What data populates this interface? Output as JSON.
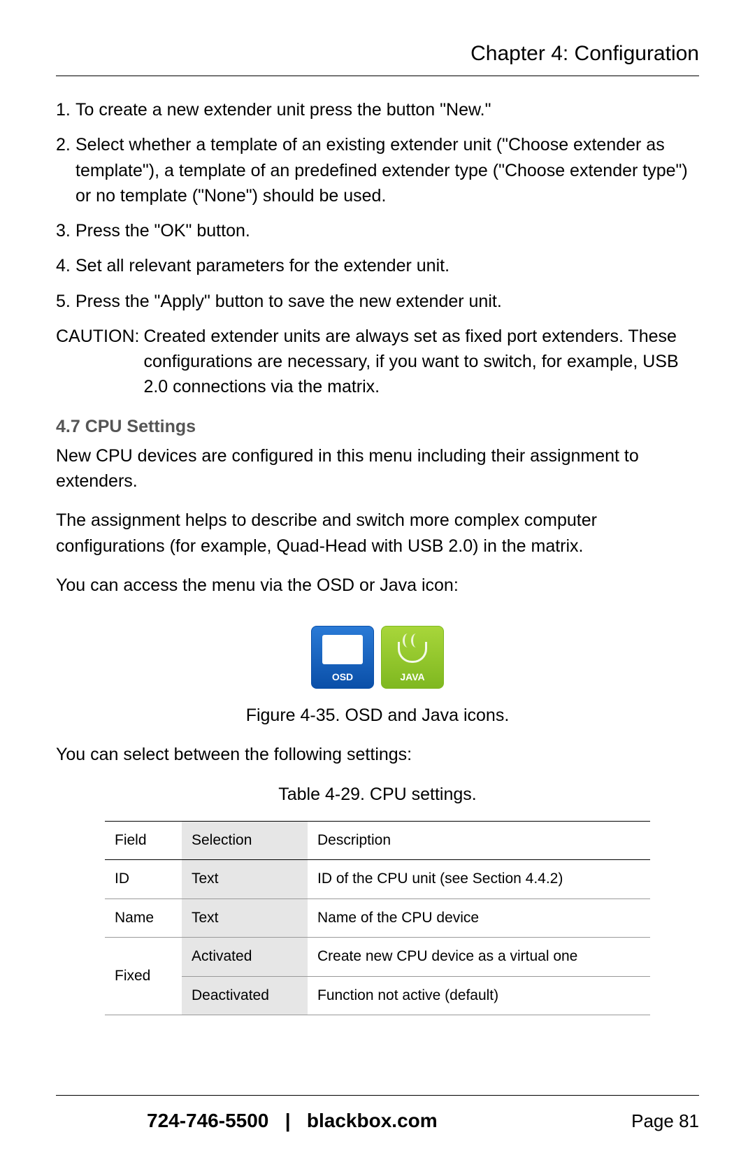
{
  "header": {
    "title": "Chapter 4: Configuration"
  },
  "steps": [
    {
      "num": "1.",
      "text": "To create a new extender unit press the button \"New.\""
    },
    {
      "num": "2.",
      "text": "Select whether a template of an existing extender unit (\"Choose extender as template\"), a template of an predefined extender type (\"Choose extender type\") or no template (\"None\") should be used."
    },
    {
      "num": "3.",
      "text": "Press the \"OK\" button."
    },
    {
      "num": "4.",
      "text": "Set all relevant parameters for the extender unit."
    },
    {
      "num": "5.",
      "text": "Press the \"Apply\" button to save the new extender unit."
    }
  ],
  "caution": {
    "label": "CAUTION:",
    "text": "Created extender units are always set as fixed port extenders. These configurations are necessary, if you want to switch, for example, USB 2.0 connections via the matrix."
  },
  "section": {
    "heading": "4.7 CPU Settings"
  },
  "paras": {
    "p1": "New CPU devices are configured in this menu including their assignment to extenders.",
    "p2": "The assignment helps to describe and switch more complex computer configurations (for example, Quad-Head with USB 2.0) in the matrix.",
    "p3": "You can access the menu via the OSD or Java icon:",
    "p4": "You can select between the following settings:"
  },
  "icons": {
    "osd": "OSD",
    "java": "JAVA"
  },
  "figure_caption": "Figure 4-35. OSD and Java icons.",
  "table_caption": "Table 4-29. CPU settings.",
  "table": {
    "headers": {
      "field": "Field",
      "selection": "Selection",
      "description": "Description"
    },
    "rows": [
      {
        "field": "ID",
        "selection": "Text",
        "description": "ID of the CPU unit (see Section 4.4.2)"
      },
      {
        "field": "Name",
        "selection": "Text",
        "description": "Name of the CPU device"
      },
      {
        "field": "Fixed",
        "selection": "Activated",
        "description": "Create new CPU device as a virtual one"
      },
      {
        "field": "",
        "selection": "Deactivated",
        "description": "Function not active (default)"
      }
    ]
  },
  "footer": {
    "phone": "724-746-5500",
    "sep": "|",
    "site": "blackbox.com",
    "page": "Page 81"
  }
}
